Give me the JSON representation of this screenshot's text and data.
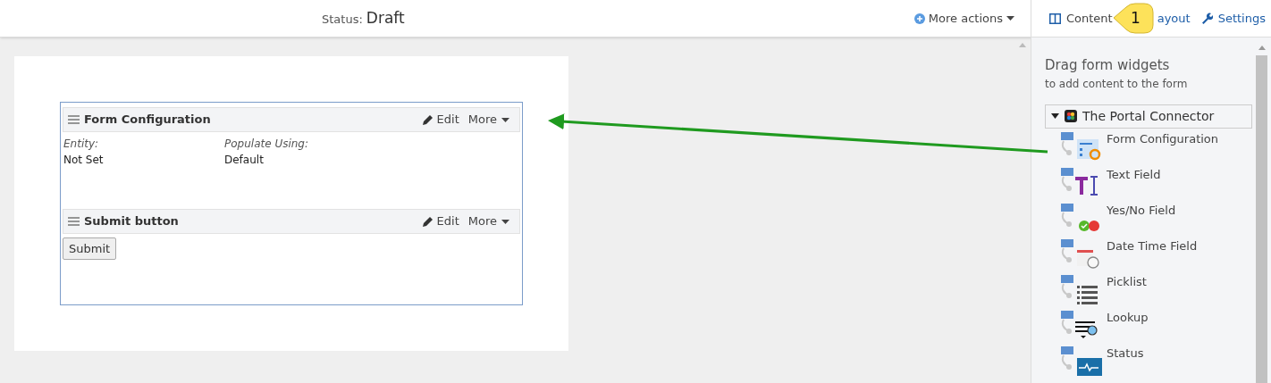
{
  "topbar": {
    "status_label": "Status:",
    "status_value": "Draft",
    "more_actions": "More actions",
    "tabs": [
      {
        "label": "Content",
        "kind": "columns"
      },
      {
        "label": "ayout",
        "kind": "plain"
      },
      {
        "label": "Settings",
        "kind": "wrench"
      }
    ]
  },
  "callout": {
    "text": "1"
  },
  "form": {
    "sections": [
      {
        "title": "Form Configuration",
        "edit": "Edit",
        "more": "More",
        "kind": "fields",
        "fields": [
          {
            "label": "Entity:",
            "value": "Not Set"
          },
          {
            "label": "Populate Using:",
            "value": "Default"
          }
        ]
      },
      {
        "title": "Submit button",
        "edit": "Edit",
        "more": "More",
        "kind": "button",
        "button": "Submit"
      }
    ]
  },
  "panel": {
    "title": "Drag form widgets",
    "subtitle": "to add content to the form",
    "group": {
      "name": "The Portal Connector",
      "expanded": true,
      "widgets": [
        {
          "label": "Form Configuration",
          "kind": "form"
        },
        {
          "label": "Text Field",
          "kind": "text"
        },
        {
          "label": "Yes/No Field",
          "kind": "yesno"
        },
        {
          "label": "Date Time Field",
          "kind": "datetime"
        },
        {
          "label": "Picklist",
          "kind": "picklist"
        },
        {
          "label": "Lookup",
          "kind": "lookup"
        },
        {
          "label": "Status",
          "kind": "status"
        }
      ]
    }
  }
}
